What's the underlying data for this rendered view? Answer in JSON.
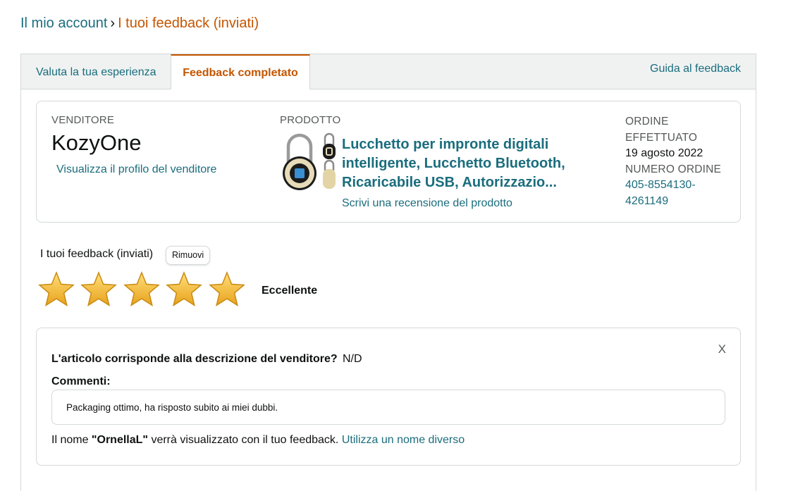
{
  "breadcrumb": {
    "parent": "Il mio account",
    "separator": "›",
    "current": "I tuoi feedback (inviati)"
  },
  "tabs": [
    {
      "label": "Valuta la tua esperienza",
      "active": false
    },
    {
      "label": "Feedback completato",
      "active": true
    }
  ],
  "guide_link": "Guida al feedback",
  "seller": {
    "label": "VENDITORE",
    "name": "KozyOne",
    "profile_link": "Visualizza il profilo del venditore"
  },
  "product": {
    "label": "PRODOTTO",
    "title": "Lucchetto per impronte digitali intelligente, Lucchetto Bluetooth, Ricaricabile USB, Autorizzazio...",
    "review_link": "Scrivi una recensione del prodotto"
  },
  "order": {
    "placed_label": "ORDINE EFFETTUATO",
    "placed_date": "19 agosto 2022",
    "number_label": "NUMERO ORDINE",
    "number": "405-8554130-4261149"
  },
  "feedback": {
    "heading": "I tuoi feedback (inviati)",
    "remove_label": "Rimuovi",
    "rating": 5,
    "rating_max": 5,
    "rating_text": "Eccellente",
    "close": "X",
    "question": "L'articolo corrisponde alla descrizione del venditore?",
    "answer": "N/D",
    "comments_label": "Commenti:",
    "comment": "Packaging ottimo, ha risposto subito ai miei dubbi.",
    "name_prefix": "Il nome",
    "name": "\"OrnellaL\"",
    "name_suffix": "verrà visualizzato con il tuo feedback.",
    "change_name_link": "Utilizza un nome diverso"
  },
  "colors": {
    "link": "#1a6d7d",
    "accent": "#c45500",
    "star": "#f5b82e"
  }
}
